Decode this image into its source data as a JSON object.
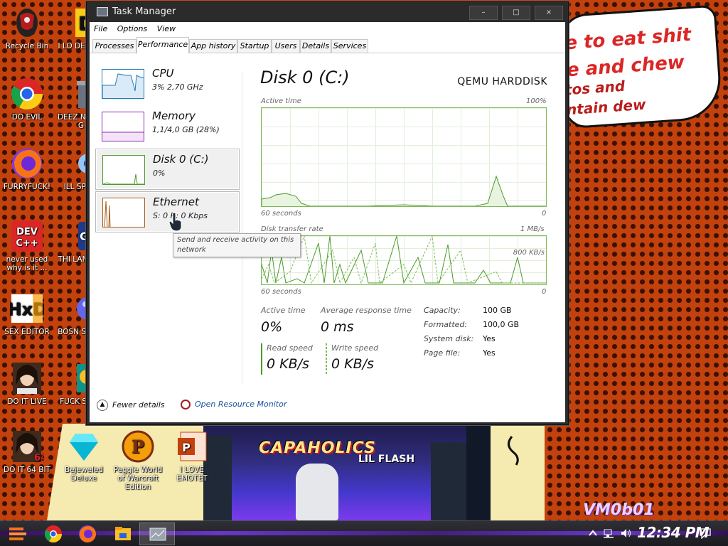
{
  "wallpaper": {
    "speech_lines": [
      "e to eat shit",
      "e and chew",
      "tos and",
      "ntain dew"
    ],
    "album_title": "CAPAHOLICS",
    "album_artist": "LIL FLASH",
    "corner_text": "VM0b01"
  },
  "desktop_icons": [
    {
      "label": "Recycle Bin",
      "icon": "recycle-bin-icon"
    },
    {
      "label": "DO EVIL",
      "icon": "chrome-icon"
    },
    {
      "label": "FURRYFUCK!",
      "icon": "firefox-icon"
    },
    {
      "label": "never used why is it ...",
      "icon": "devcpp-icon"
    },
    {
      "label": "SEX EDITOR",
      "icon": "hxd-icon"
    },
    {
      "label": "DO IT LIVE",
      "icon": "portrait-icon"
    },
    {
      "label": "DO IT 64 BIT",
      "icon": "portrait-64-icon"
    },
    {
      "label": "I LO DETECT",
      "icon": "app-icon"
    },
    {
      "label": "DEEZ N HAH G",
      "icon": "trash-can-icon"
    },
    {
      "label": "ILL SP YO",
      "icon": "gear-app-icon"
    },
    {
      "label": "THI LANGUA",
      "icon": "go-icon"
    },
    {
      "label": "BOSN SIMUL",
      "icon": "ball-icon"
    },
    {
      "label": "FUCK S ELV",
      "icon": "game-icon"
    },
    {
      "label": "Bejeweled Deluxe",
      "icon": "gem-icon"
    },
    {
      "label": "Peggle World of Warcraft Edition",
      "icon": "peggle-icon"
    },
    {
      "label": "I LOVE EMOTET",
      "icon": "powerpoint-icon"
    }
  ],
  "window": {
    "title": "Task Manager",
    "controls": {
      "minimize": "–",
      "maximize": "□",
      "close": "×"
    },
    "menu": [
      "File",
      "Options",
      "View"
    ],
    "tabs": [
      "Processes",
      "Performance",
      "App history",
      "Startup",
      "Users",
      "Details",
      "Services"
    ],
    "active_tab": "Performance"
  },
  "sidebar": [
    {
      "name": "CPU",
      "value": "3%  2,70 GHz",
      "color": "#1f7ab8"
    },
    {
      "name": "Memory",
      "value": "1,1/4,0 GB (28%)",
      "color": "#8b2bb0"
    },
    {
      "name": "Disk 0 (C:)",
      "value": "0%",
      "color": "#4c9a2a"
    },
    {
      "name": "Ethernet",
      "value": "S: 0 R: 0 Kbps",
      "color": "#a65d1a"
    }
  ],
  "tooltip": "Send and receive activity on this network",
  "disk": {
    "title": "Disk 0 (C:)",
    "model": "QEMU HARDDISK",
    "active_time_label": "Active time",
    "active_time_max": "100%",
    "graph1_time": "60 seconds",
    "graph1_min": "0",
    "transfer_label": "Disk transfer rate",
    "transfer_max": "1 MB/s",
    "transfer_mid": "800 KB/s",
    "graph2_time": "60 seconds",
    "graph2_min": "0",
    "stats": {
      "active_time_label": "Active time",
      "active_time_value": "0%",
      "response_label": "Average response time",
      "response_value": "0 ms",
      "read_label": "Read speed",
      "read_value": "0 KB/s",
      "write_label": "Write speed",
      "write_value": "0 KB/s"
    },
    "properties": [
      {
        "label": "Capacity:",
        "value": "100 GB"
      },
      {
        "label": "Formatted:",
        "value": "100,0 GB"
      },
      {
        "label": "System disk:",
        "value": "Yes"
      },
      {
        "label": "Page file:",
        "value": "Yes"
      }
    ]
  },
  "footer": {
    "fewer_details": "Fewer details",
    "resource_monitor": "Open Resource Monitor"
  },
  "taskbar": {
    "clock": "12:34 PM",
    "apps": [
      "start-icon",
      "chrome-icon",
      "firefox-icon",
      "file-explorer-icon",
      "task-manager-icon"
    ]
  },
  "colors": {
    "disk_green": "#4c9a2a",
    "cpu_blue": "#1f7ab8",
    "memory_purple": "#8b2bb0",
    "ethernet_brown": "#a65d1a"
  }
}
